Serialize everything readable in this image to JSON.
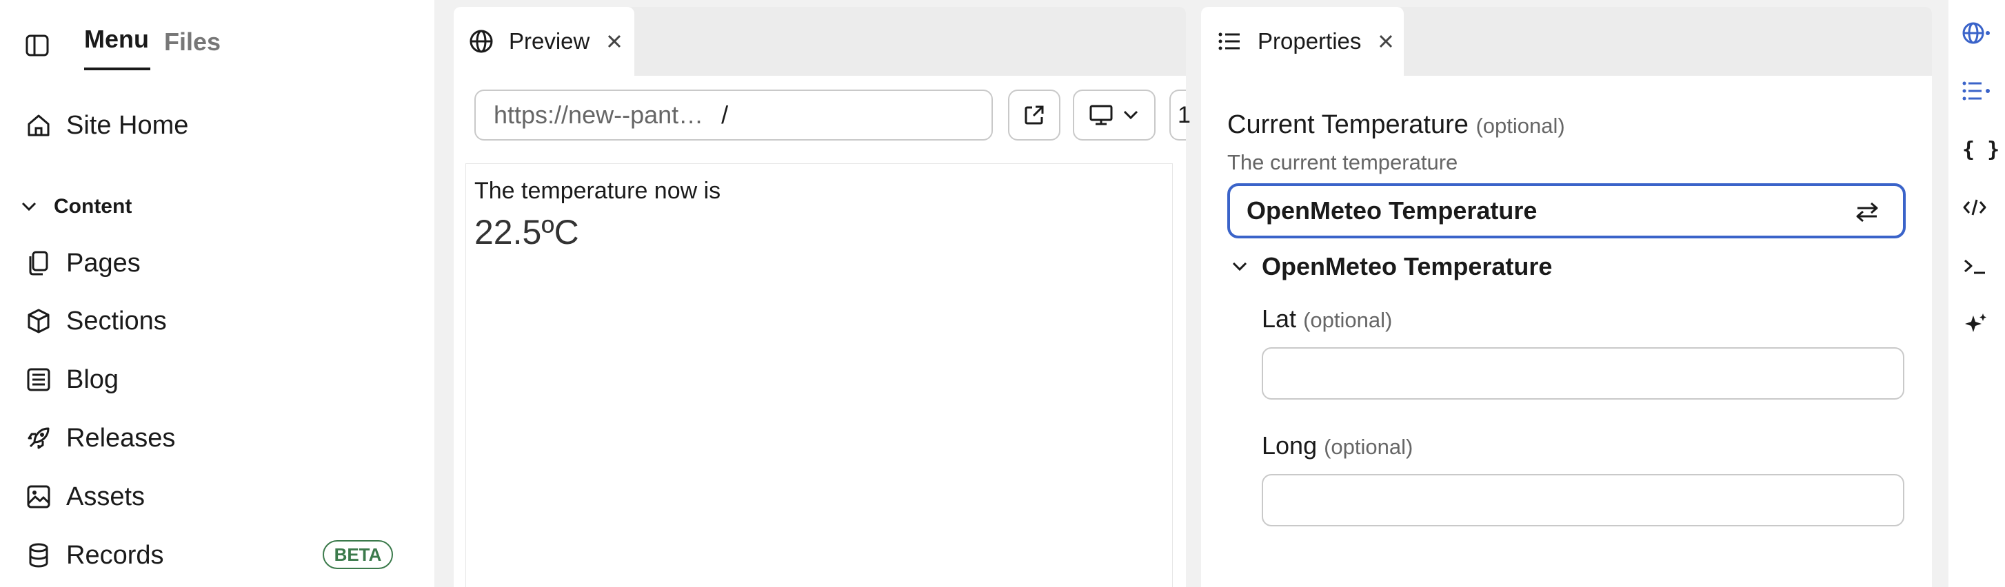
{
  "sidebar": {
    "tabs": [
      "Menu",
      "Files"
    ],
    "site_home": "Site Home",
    "content_heading": "Content",
    "items": [
      {
        "label": "Pages",
        "icon": "pages-icon"
      },
      {
        "label": "Sections",
        "icon": "cube-icon"
      },
      {
        "label": "Blog",
        "icon": "blog-icon"
      },
      {
        "label": "Releases",
        "icon": "rocket-icon"
      },
      {
        "label": "Assets",
        "icon": "image-icon"
      },
      {
        "label": "Records",
        "icon": "database-icon",
        "badge": "BETA"
      }
    ]
  },
  "preview": {
    "tab_label": "Preview",
    "url": "https://new--pant…",
    "path": "/",
    "partial_button_text": "1",
    "content_line": "The temperature now is",
    "temperature": "22.5ºC"
  },
  "properties": {
    "tab_label": "Properties",
    "field_label": "Current Temperature",
    "optional_text": "(optional)",
    "field_description": "The current temperature",
    "selected_value": "OpenMeteo Temperature",
    "section_title": "OpenMeteo Temperature",
    "lat_label": "Lat",
    "long_label": "Long",
    "lat_value": "",
    "long_value": ""
  },
  "rail_icons": [
    "globe-icon",
    "list-icon",
    "braces-icon",
    "code-icon",
    "terminal-icon",
    "sparkle-icon"
  ],
  "colors": {
    "accent": "#3a63c9",
    "badge_green": "#3b7a4b",
    "panel_bg": "#ffffff",
    "app_bg": "#f1f1f1"
  }
}
